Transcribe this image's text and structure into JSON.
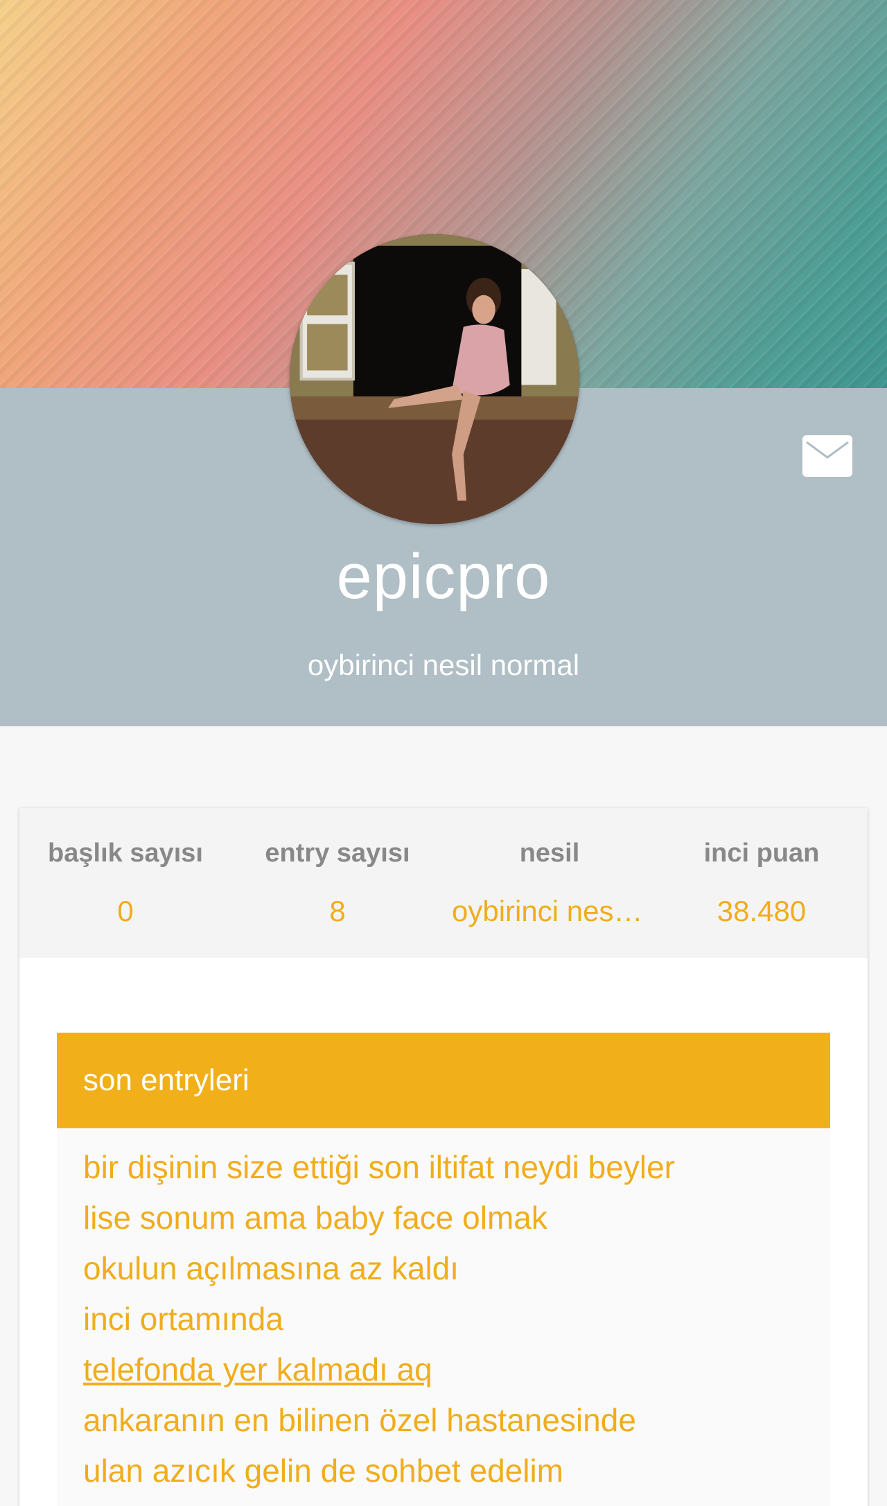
{
  "profile": {
    "username": "epicpro",
    "subtitle": "oybirinci nesil normal"
  },
  "icons": {
    "message": "mail-icon",
    "avatar": "profile-photo"
  },
  "colors": {
    "accent": "#f0ad1c",
    "header_bar": "#f1b01a",
    "band": "#b0bec5"
  },
  "stats": [
    {
      "label": "başlık sayısı",
      "value": "0"
    },
    {
      "label": "entry sayısı",
      "value": "8"
    },
    {
      "label": "nesil",
      "value": "oybirinci nesi…"
    },
    {
      "label": "inci puan",
      "value": "38.480"
    }
  ],
  "entries": {
    "header": "son entryleri",
    "items": [
      "bir dişinin size ettiği son iltifat neydi beyler",
      "lise sonum ama baby face olmak",
      "okulun açılmasına az kaldı",
      "inci ortamında",
      "telefonda yer kalmadı aq",
      "ankaranın en bilinen özel hastanesinde",
      "ulan azıcık gelin de sohbet edelim"
    ]
  }
}
